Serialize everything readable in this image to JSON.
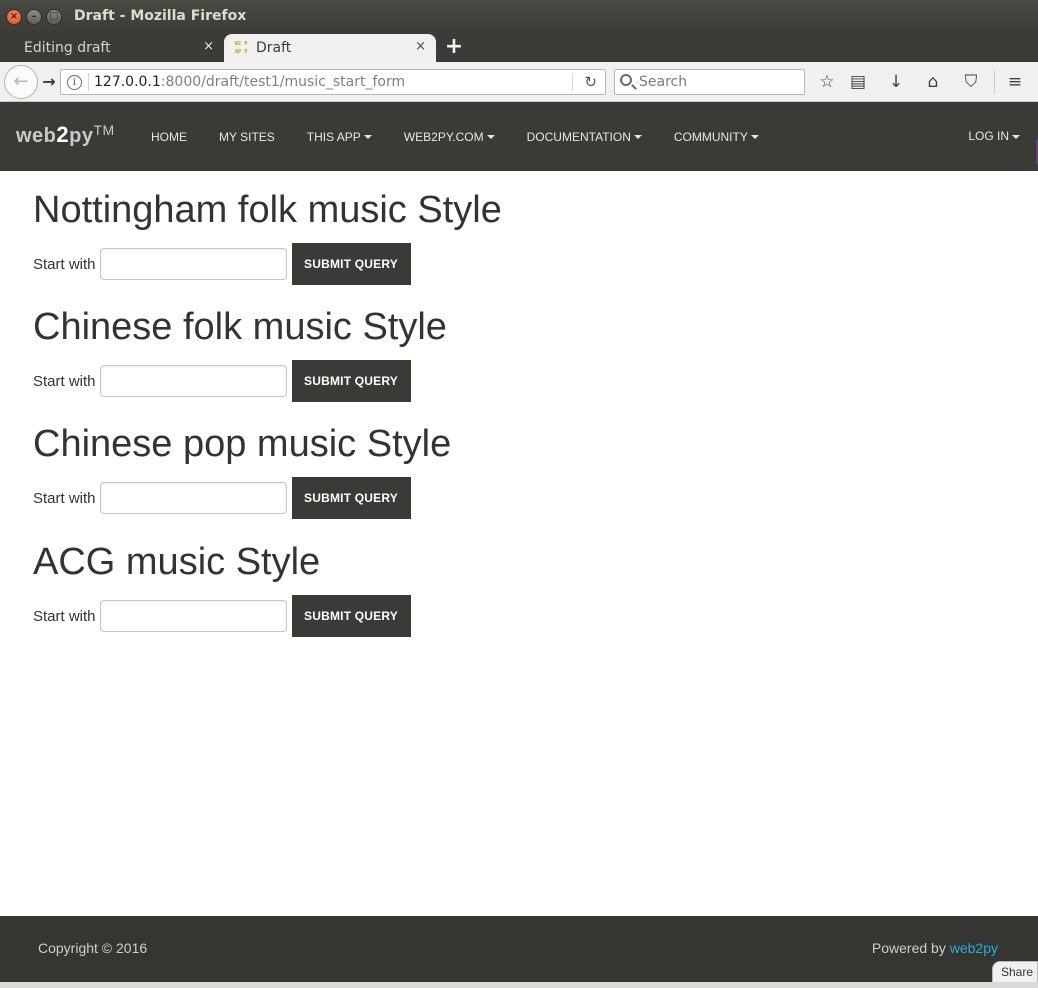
{
  "window": {
    "title": "Draft - Mozilla Firefox",
    "controls": [
      "×",
      "–",
      "□"
    ]
  },
  "tabs": [
    {
      "label": "Editing draft",
      "active": false,
      "close": "×"
    },
    {
      "label": "Draft",
      "active": true,
      "close": "×",
      "favicon_text": [
        "W2",
        "P",
        "AP",
        "P"
      ]
    }
  ],
  "new_tab_label": "+",
  "toolbar": {
    "back_icon": "←",
    "forward_icon": "→",
    "info_icon": "i",
    "url_host": "127.0.0.1",
    "url_path": ":8000/draft/test1/music_start_form",
    "reload_icon": "↻",
    "search_placeholder": "Search",
    "icons": {
      "bookmark": "☆",
      "reading_list": "▤",
      "download": "↓",
      "home": "⌂",
      "pocket": "⛉",
      "menu": "≡"
    }
  },
  "site_nav": {
    "brand_prefix": "web",
    "brand_two": "2",
    "brand_suffix": "py",
    "brand_tm": "TM",
    "items": [
      {
        "label": "HOME",
        "dropdown": false
      },
      {
        "label": "MY SITES",
        "dropdown": false
      },
      {
        "label": "THIS APP",
        "dropdown": true
      },
      {
        "label": "WEB2PY.COM",
        "dropdown": true
      },
      {
        "label": "DOCUMENTATION",
        "dropdown": true
      },
      {
        "label": "COMMUNITY",
        "dropdown": true
      }
    ],
    "login": "LOG IN"
  },
  "styles": [
    {
      "heading": "Nottingham folk music Style",
      "label": "Start with",
      "input_value": "",
      "button": "SUBMIT QUERY"
    },
    {
      "heading": "Chinese folk music Style",
      "label": "Start with",
      "input_value": "",
      "button": "SUBMIT QUERY"
    },
    {
      "heading": "Chinese pop music Style",
      "label": "Start with",
      "input_value": "",
      "button": "SUBMIT QUERY"
    },
    {
      "heading": "ACG music Style",
      "label": "Start with",
      "input_value": "",
      "button": "SUBMIT QUERY"
    }
  ],
  "footer": {
    "copyright": "Copyright © 2016",
    "powered_by": "Powered by ",
    "powered_link": "web2py",
    "link_color": "#29abe0"
  },
  "share_label": "Share"
}
